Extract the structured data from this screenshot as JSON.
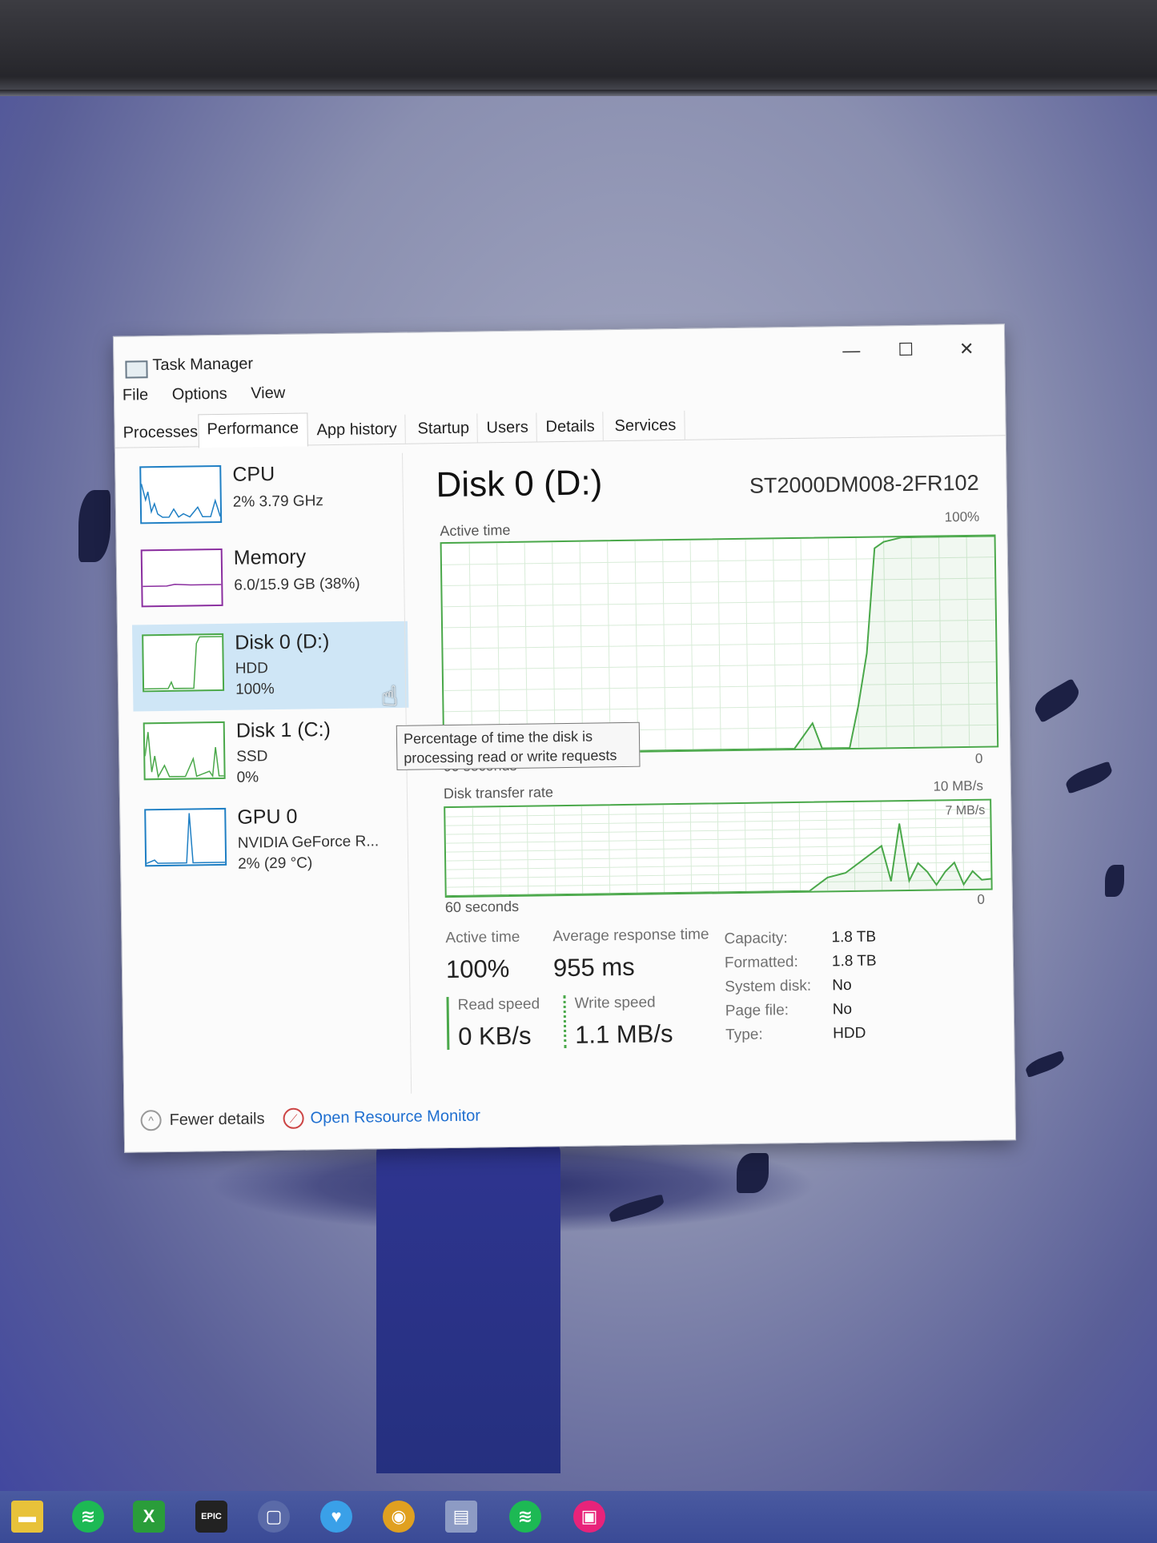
{
  "window": {
    "title": "Task Manager",
    "controls": {
      "minimize": "—",
      "maximize": "☐",
      "close": "✕"
    }
  },
  "menu": [
    "File",
    "Options",
    "View"
  ],
  "tabs": [
    "Processes",
    "Performance",
    "App history",
    "Startup",
    "Users",
    "Details",
    "Services"
  ],
  "active_tab": "Performance",
  "sidebar": {
    "items": [
      {
        "name": "CPU",
        "line1": "2%  3.79 GHz",
        "line2": "",
        "color": "#1f7fc4"
      },
      {
        "name": "Memory",
        "line1": "6.0/15.9 GB (38%)",
        "line2": "",
        "color": "#8a2e9f"
      },
      {
        "name": "Disk 0 (D:)",
        "line1": "HDD",
        "line2": "100%",
        "color": "#4aa84a"
      },
      {
        "name": "Disk 1 (C:)",
        "line1": "SSD",
        "line2": "0%",
        "color": "#4aa84a"
      },
      {
        "name": "GPU 0",
        "line1": "NVIDIA GeForce R...",
        "line2": "2%  (29 °C)",
        "color": "#1f7fc4"
      }
    ],
    "selected_index": 2
  },
  "main": {
    "title": "Disk 0 (D:)",
    "model": "ST2000DM008-2FR102",
    "active_time_graph": {
      "label": "Active time",
      "max_label": "100%",
      "time_label": "60 seconds",
      "min_label": "0"
    },
    "transfer_graph": {
      "label": "Disk transfer rate",
      "max_label": "10 MB/s",
      "inner_label": "7 MB/s",
      "time_label": "60 seconds",
      "min_label": "0"
    },
    "tooltip": "Percentage of time the disk is processing read or write requests",
    "stats": {
      "active_time_label": "Active time",
      "active_time_value": "100%",
      "response_label": "Average response time",
      "response_value": "955 ms",
      "read_label": "Read speed",
      "read_value": "0 KB/s",
      "write_label": "Write speed",
      "write_value": "1.1 MB/s"
    },
    "properties": [
      {
        "key": "Capacity:",
        "value": "1.8 TB"
      },
      {
        "key": "Formatted:",
        "value": "1.8 TB"
      },
      {
        "key": "System disk:",
        "value": "No"
      },
      {
        "key": "Page file:",
        "value": "No"
      },
      {
        "key": "Type:",
        "value": "HDD"
      }
    ]
  },
  "footer": {
    "fewer_details": "Fewer details",
    "resource_monitor": "Open Resource Monitor"
  },
  "chart_data": [
    {
      "type": "line",
      "title": "Active time",
      "ylim": [
        0,
        100
      ],
      "x": [
        60,
        50,
        40,
        30,
        22,
        20,
        19,
        16,
        15,
        14,
        13,
        12,
        10,
        8,
        5,
        0
      ],
      "values": [
        0,
        0,
        0,
        0,
        0,
        12,
        0,
        0,
        20,
        45,
        95,
        98,
        100,
        100,
        100,
        100
      ]
    },
    {
      "type": "line",
      "title": "Disk transfer rate",
      "ylim": [
        0,
        10
      ],
      "x": [
        60,
        40,
        20,
        18,
        16,
        14,
        12,
        11,
        10,
        9,
        8,
        7,
        6,
        5,
        4,
        3,
        2,
        1,
        0
      ],
      "values": [
        0,
        0,
        0,
        1.5,
        2,
        3.5,
        5,
        1,
        7.5,
        1,
        3,
        2,
        0.5,
        2,
        3,
        0.5,
        2,
        1,
        1.1
      ]
    }
  ],
  "taskbar": [
    {
      "name": "file-explorer",
      "color": "#e8c23a",
      "glyph": "▬"
    },
    {
      "name": "spotify",
      "color": "#1db954",
      "glyph": "≋"
    },
    {
      "name": "xbox",
      "color": "#2a9d3a",
      "glyph": "X"
    },
    {
      "name": "epic-games",
      "color": "#222222",
      "glyph": "EPIC"
    },
    {
      "name": "mouse-app",
      "color": "#5a6aa8",
      "glyph": "▢"
    },
    {
      "name": "heart-app",
      "color": "#3aa0e8",
      "glyph": "♥"
    },
    {
      "name": "chrome",
      "color": "#e0a020",
      "glyph": "◉"
    },
    {
      "name": "task-manager",
      "color": "#8d9bc4",
      "glyph": "▤"
    },
    {
      "name": "spotify-2",
      "color": "#1db954",
      "glyph": "≋"
    },
    {
      "name": "pink-app",
      "color": "#e8237a",
      "glyph": "▣"
    }
  ]
}
